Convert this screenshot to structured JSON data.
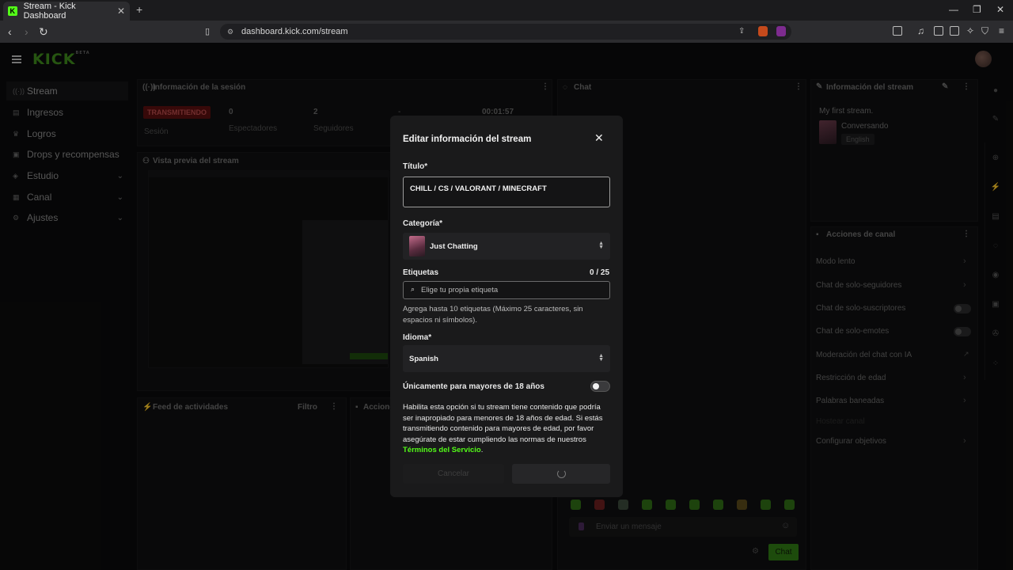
{
  "browser": {
    "tab_title": "Stream - Kick Dashboard",
    "tab_favicon": "K",
    "url": "dashboard.kick.com/stream"
  },
  "app": {
    "logo": "KICK",
    "logo_tag": "BETA"
  },
  "sidebar": {
    "items": [
      {
        "label": "Stream",
        "icon": "broadcast-icon"
      },
      {
        "label": "Ingresos",
        "icon": "money-icon"
      },
      {
        "label": "Logros",
        "icon": "trophy-icon"
      },
      {
        "label": "Drops y recompensas",
        "icon": "gift-icon"
      },
      {
        "label": "Estudio",
        "icon": "layers-icon"
      },
      {
        "label": "Canal",
        "icon": "channel-icon"
      },
      {
        "label": "Ajustes",
        "icon": "gear-icon"
      }
    ]
  },
  "session": {
    "title": "Información de la sesión",
    "live_badge": "TRANSMITIENDO",
    "session_label": "Sesión",
    "viewers_value": "0",
    "viewers_label": "Espectadores",
    "followers_value": "2",
    "followers_label": "Seguidores",
    "dash": "-",
    "duration": "00:01:57"
  },
  "preview": {
    "title": "Vista previa del stream"
  },
  "feed": {
    "title": "Feed de actividades",
    "filter": "Filtro"
  },
  "actions_panel": {
    "title": "Acciones"
  },
  "chat": {
    "title": "Chat",
    "placeholder": "Enviar un mensaje",
    "send_label": "Chat"
  },
  "stream_info": {
    "title": "Información del stream",
    "stream_title": "My first stream.",
    "category": "Conversando",
    "language": "English"
  },
  "channel_actions": {
    "title": "Acciones de canal",
    "rows": [
      {
        "label": "Modo lento",
        "control": "chevron"
      },
      {
        "label": "Chat de solo-seguidores",
        "control": "chevron"
      },
      {
        "label": "Chat de solo-suscriptores",
        "control": "toggle"
      },
      {
        "label": "Chat de solo-emotes",
        "control": "toggle"
      },
      {
        "label": "Moderación del chat con IA",
        "control": "external"
      },
      {
        "label": "Restricción de edad",
        "control": "chevron"
      },
      {
        "label": "Palabras baneadas",
        "control": "chevron"
      },
      {
        "label": "Hostear canal",
        "control": "none"
      },
      {
        "label": "Configurar objetivos",
        "control": "chevron"
      }
    ]
  },
  "modal": {
    "title": "Editar información del stream",
    "title_label": "Título*",
    "title_value": "CHILL / CS / VALORANT / MINECRAFT",
    "category_label": "Categoría*",
    "category_value": "Just Chatting",
    "tags_label": "Etiquetas",
    "tags_counter": "0 / 25",
    "tags_placeholder": "Elige tu propia etiqueta",
    "tags_help": "Agrega hasta 10 etiquetas (Máximo 25 caracteres, sin espacios ni símbolos).",
    "language_label": "Idioma*",
    "language_value": "Spanish",
    "adult_label": "Únicamente para mayores de 18 años",
    "adult_enabled": false,
    "adult_desc": "Habilita esta opción si tu stream tiene contenido que podría ser inapropiado para menores de 18 años de edad. Si estás transmitiendo contenido para mayores de edad, por favor asegúrate de estar cumpliendo las normas de nuestros ",
    "terms_link": "Términos del Servicio",
    "terms_suffix": ".",
    "cancel_label": "Cancelar",
    "save_state": "loading"
  },
  "colors": {
    "brand": "#53fc18",
    "live": "#b84b4b"
  }
}
